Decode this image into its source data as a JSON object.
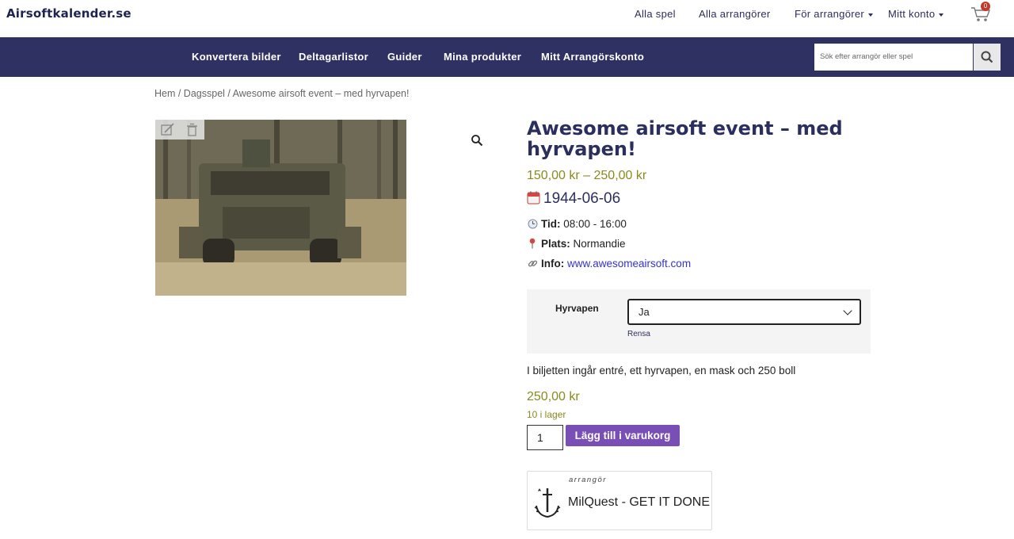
{
  "header": {
    "logo": "Airsoftkalender.se",
    "nav": [
      {
        "label": "Alla spel",
        "dropdown": false
      },
      {
        "label": "Alla arrangörer",
        "dropdown": false
      },
      {
        "label": "För arrangörer",
        "dropdown": true
      },
      {
        "label": "Mitt konto",
        "dropdown": true
      }
    ],
    "cart_count": "0"
  },
  "navbar": {
    "items": [
      "Konvertera bilder",
      "Deltagarlistor",
      "Guider",
      "Mina produkter",
      "Mitt Arrangörskonto"
    ],
    "search_placeholder": "Sök efter arrangör eller spel"
  },
  "breadcrumb": "Hem / Dagsspel / Awesome airsoft event – med hyrvapen!",
  "product": {
    "title": "Awesome airsoft event – med hyrvapen!",
    "price_range": "150,00 kr – 250,00 kr",
    "date": "1944-06-06",
    "time_label": "Tid:",
    "time_value": "08:00 - 16:00",
    "place_label": "Plats:",
    "place_value": "Normandie",
    "info_label": "Info:",
    "info_link": "www.awesomeairsoft.com",
    "variation_label": "Hyrvapen",
    "variation_value": "Ja",
    "variation_clear": "Rensa",
    "description": "I biljetten ingår entré, ett hyrvapen, en mask och 250 boll",
    "price": "250,00 kr",
    "stock": "10 i lager",
    "quantity": "1",
    "add_to_cart": "Lägg till i varukorg"
  },
  "organizer": {
    "tag": "arrangör",
    "name": "MilQuest - GET IT DONE"
  },
  "colors": {
    "navbar": "#2f3163",
    "title": "#2b2f5e",
    "price": "#8a8a1f",
    "button": "#7a4fb5",
    "link": "#3333cc"
  }
}
